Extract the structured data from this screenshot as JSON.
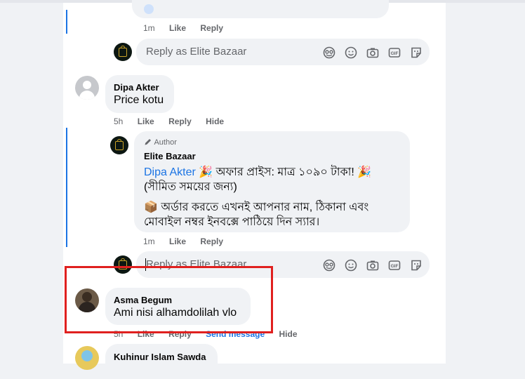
{
  "thread_top": {
    "time": "1m",
    "like": "Like",
    "reply": "Reply"
  },
  "reply_box_1": {
    "placeholder": "Reply as Elite Bazaar"
  },
  "comment_dipa": {
    "name": "Dipa Akter",
    "text": "Price kotu",
    "time": "5h",
    "like": "Like",
    "reply": "Reply",
    "hide": "Hide"
  },
  "author_reply": {
    "badge": "Author",
    "name": "Elite Bazaar",
    "mention": "Dipa Akter",
    "line1_rest": "🎉 অফার প্রাইস: মাত্র ১০৯০ টাকা! 🎉",
    "line2": "(সীমিত সময়ের জন্য)",
    "line3": "📦 অর্ডার করতে এখনই আপনার নাম, ঠিকানা এবং",
    "line4": "মোবাইল নম্বর ইনবক্সে পাঠিয়ে দিন স্যার।",
    "time": "1m",
    "like": "Like",
    "reply": "Reply"
  },
  "reply_box_2": {
    "placeholder": "Reply as Elite Bazaar"
  },
  "comment_asma": {
    "name": "Asma Begum",
    "text": "Ami nisi alhamdolilah vlo",
    "time": "5h",
    "like": "Like",
    "reply": "Reply",
    "send_message": "Send message",
    "hide": "Hide"
  },
  "comment_kuhinur": {
    "name": "Kuhinur Islam Sawda"
  },
  "colors": {
    "accent": "#1b74e4",
    "highlight": "#e0201f",
    "bubble": "#f0f2f5",
    "meta": "#65676b"
  },
  "icons": [
    "emoji-mask-icon",
    "smiley-icon",
    "camera-icon",
    "gif-icon",
    "sticker-icon"
  ]
}
